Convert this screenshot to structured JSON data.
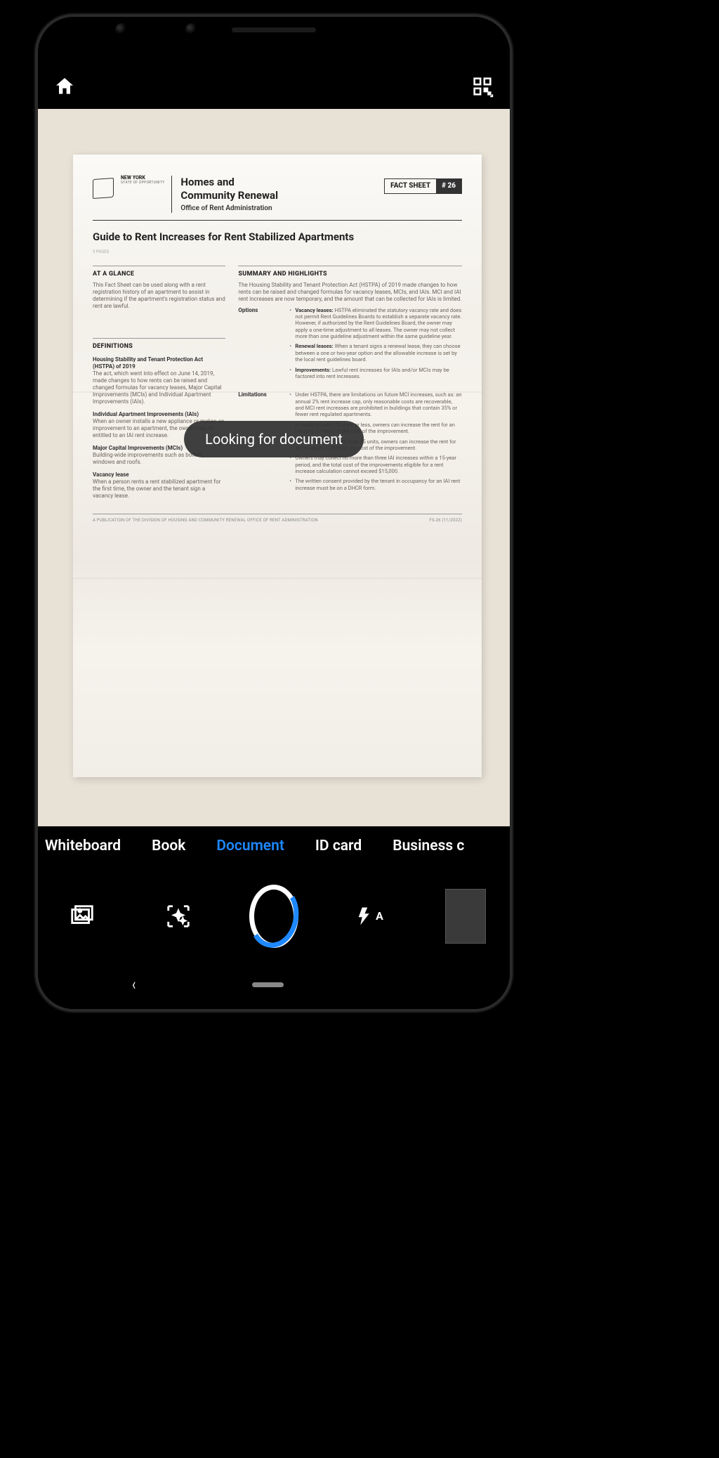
{
  "toast": {
    "message": "Looking for document"
  },
  "modes": {
    "items": [
      {
        "label": "Whiteboard",
        "active": false
      },
      {
        "label": "Book",
        "active": false
      },
      {
        "label": "Document",
        "active": true
      },
      {
        "label": "ID card",
        "active": false
      },
      {
        "label": "Business c",
        "active": false
      }
    ]
  },
  "icons": {
    "home": "home-icon",
    "qr": "qr-icon",
    "gallery": "gallery-icon",
    "enhance": "enhance-icon",
    "flash": "flash-auto-icon"
  },
  "flash": {
    "mode": "A"
  },
  "document": {
    "logo": {
      "state": "NEW YORK",
      "sub": "STATE OF OPPORTUNITY"
    },
    "agency": {
      "line1": "Homes and",
      "line2": "Community Renewal",
      "line3": "Office of Rent Administration"
    },
    "badge": {
      "left": "FACT SHEET",
      "right": "# 26"
    },
    "title": "Guide to Rent Increases for Rent Stabilized Apartments",
    "pages": "3 PAGES",
    "left_col": {
      "glance_head": "AT A GLANCE",
      "glance_body": "This Fact Sheet can be used along with a rent registration history of an apartment to assist in determining if the apartment's registration status and rent are lawful.",
      "defs_head": "DEFINITIONS",
      "hstpa_head": "Housing Stability and Tenant Protection Act (HSTPA) of 2019",
      "hstpa_body": "The act, which went into effect on June 14, 2019, made changes to how rents can be raised and changed formulas for vacancy leases, Major Capital Improvements (MCIs) and Individual Apartment Improvements (IAIs).",
      "iai_head": "Individual Apartment Improvements (IAIs)",
      "iai_body": "When an owner installs a new appliance or makes an improvement to an apartment, the owner may be entitled to an IAI rent increase.",
      "mci_head": "Major Capital Improvements (MCIs)",
      "mci_body": "Building-wide improvements such as boilers, windows and roofs.",
      "vac_head": "Vacancy lease",
      "vac_body": "When a person rents a rent stabilized apartment for the first time, the owner and the tenant sign a vacancy lease."
    },
    "right_col": {
      "summary_head": "SUMMARY AND HIGHLIGHTS",
      "summary_body": "The Housing Stability and Tenant Protection Act (HSTPA) of 2019 made changes to how rents can be raised and changed formulas for vacancy leases, MCIs, and IAIs. MCI and IAI rent increases are now temporary, and the amount that can be collected for IAIs is limited.",
      "options_label": "Options",
      "options": [
        {
          "strong": "Vacancy leases:",
          "text": " HSTPA eliminated the statutory vacancy rate and does not permit Rent Guidelines Boards to establish a separate vacancy rate. However, if authorized by the Rent Guidelines Board, the owner may apply a one-time adjustment to all leases. The owner may not collect more than one guideline adjustment within the same guideline year."
        },
        {
          "strong": "Renewal leases:",
          "text": " When a tenant signs a renewal lease, they can choose between a one or two-year option and the allowable increase is set by the local rent guidelines board."
        },
        {
          "strong": "Improvements:",
          "text": " Lawful rent increases for IAIs and/or MCIs may be factored into rent increases."
        }
      ],
      "limitations_label": "Limitations",
      "limitations": [
        {
          "text": "Under HSTPA, there are limitations on future MCI increases, such as: an annual 2% rent increase cap, only reasonable costs are recoverable, and MCI rent increases are prohibited in buildings that contain 35% or fewer rent regulated apartments."
        },
        {
          "text": "In buildings with 35 units or less, owners can increase the rent for an IAI up to 1/168th of the cost of the improvement."
        },
        {
          "text": "In buildings with more than 35 units, owners can increase the rent for an IAI up to 1/180th of the cost of the improvement."
        },
        {
          "text": "Owners may collect no more than three IAI increases within a 15-year period, and the total cost of the improvements eligible for a rent increase calculation cannot exceed $15,000."
        },
        {
          "text": "The written consent provided by the tenant in occupancy for an IAI rent increase must be on a DHCR form."
        }
      ]
    },
    "footer": {
      "left": "A PUBLICATION OF THE DIVISION OF HOUSING AND COMMUNITY RENEWAL OFFICE OF RENT ADMINISTRATION",
      "right": "FS-26 (11/2022)"
    }
  }
}
